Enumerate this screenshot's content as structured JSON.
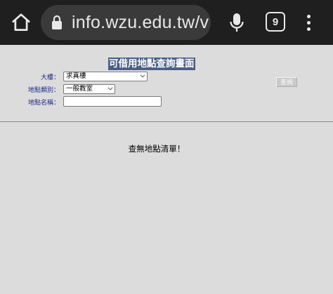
{
  "browser": {
    "url": "info.wzu.edu.tw/v",
    "tab_count": "9"
  },
  "form": {
    "title": "可借用地點查詢畫面",
    "building_label": "大樓：",
    "building_value": "求真樓",
    "type_label": "地點類別：",
    "type_value": "一般教室",
    "name_label": "地點名稱：",
    "name_value": "",
    "query_button": "查詢"
  },
  "result": {
    "message": "查無地點清單！"
  }
}
